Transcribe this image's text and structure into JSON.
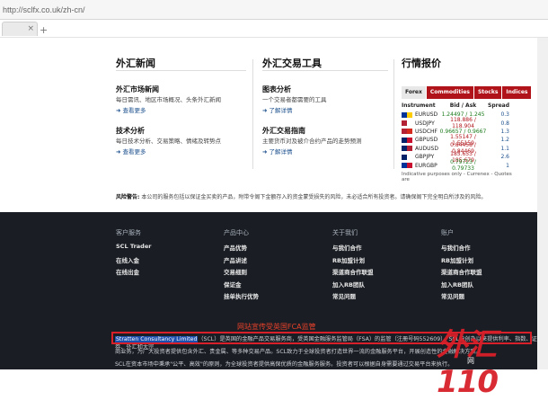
{
  "browser": {
    "url": "http://sclfx.co.uk/zh-cn/"
  },
  "columns": [
    {
      "title": "外汇新闻",
      "items": [
        {
          "title": "外汇市场新闻",
          "desc": "每日需讯、地区市场概况、头条外汇新闻",
          "more": "查看更多"
        },
        {
          "title": "技术分析",
          "desc": "每日技术分析、交易策略、情绪及转势点",
          "more": "查看更多"
        }
      ]
    },
    {
      "title": "外汇交易工具",
      "items": [
        {
          "title": "图表分析",
          "desc": "一个交易者都需要的工具",
          "more": "了解详情"
        },
        {
          "title": "外汇交易指南",
          "desc": "主要货币对及被介合约产品的走势预测",
          "more": "了解详情"
        }
      ]
    }
  ],
  "quotes": {
    "title": "行情报价",
    "tabs": [
      "Forex",
      "Commodities",
      "Stocks",
      "Indices"
    ],
    "headers": {
      "instrument": "Instrument",
      "bidask": "Bid / Ask",
      "spread": "Spread"
    },
    "rows": [
      {
        "symbol": "EURUSD",
        "bidask": "1.24497 / 1.245",
        "spread": "0.3",
        "dir": "up"
      },
      {
        "symbol": "USDJPY",
        "bidask": "118.886 / 118.904",
        "spread": "0.8",
        "dir": "down"
      },
      {
        "symbol": "USDCHF",
        "bidask": "0.96657 / 0.9667",
        "spread": "1.3",
        "dir": "up"
      },
      {
        "symbol": "GBPUSD",
        "bidask": "1.55147 / 1.55159",
        "spread": "1.2",
        "dir": "down"
      },
      {
        "symbol": "AUDUSD",
        "bidask": "0.84458 / 0.84469",
        "spread": "1.1",
        "dir": "down"
      },
      {
        "symbol": "GBPJPY",
        "bidask": "185.653 / 185.679",
        "spread": "2.6",
        "dir": "down"
      },
      {
        "symbol": "EURGBP",
        "bidask": "0.79723 / 0.79733",
        "spread": "1",
        "dir": "up"
      }
    ],
    "footnote": "Indicative purposes only - Currenex - Quotes are"
  },
  "risk": {
    "label": "风险警告:",
    "text": " 本公司的服务包括以保证金买卖的产品，附带令阁下金额存入的资金蒙受损失的风险，未必适合所有投资者。请确保阁下完全明白所涉及的风险。"
  },
  "footer": {
    "columns": [
      {
        "heading": "客户服务",
        "links": [
          "SCL Trader",
          "在线入金",
          "在线出金"
        ]
      },
      {
        "heading": "产品中心",
        "links": [
          "产品优势",
          "产品讲述",
          "交易细则",
          "保证金",
          "挂单执行优势"
        ]
      },
      {
        "heading": "关于我们",
        "links": [
          "与我们合作",
          "RB加盟计划",
          "渠道商合作联盟",
          "加入RB团队",
          "常见问题"
        ]
      },
      {
        "heading": "账户",
        "links": [
          "与我们合作",
          "RB加盟计划",
          "渠道商合作联盟",
          "加入RB团队",
          "常见问题"
        ]
      }
    ],
    "fca_notice": "网站宣传受英国FCA监管",
    "highlight": "Stratten Consultancy Limited",
    "text1": "（SCL）是英国的金融产品交易服务商，受英国金融服务监管局（FSA）的监管（注册号码552609），SCL自创办以来提供利率、指数、证券、外汇和大宗",
    "text2": "商业务，为广大投资者提供包含外汇、贵金属、等多种交易产品。SCL致力于全球投资者打造世界一流的金融服务平台，开展创造性的金融解决方案。",
    "text3": "SCL在资本市场中秉承\"公平、高效\"的原则，为全球投资者提供高保优质的金融服务服务。投资者可以根据自身需要通过交易平台来执行。",
    "watermark": "外汇110",
    "watermark_sub": "网"
  }
}
